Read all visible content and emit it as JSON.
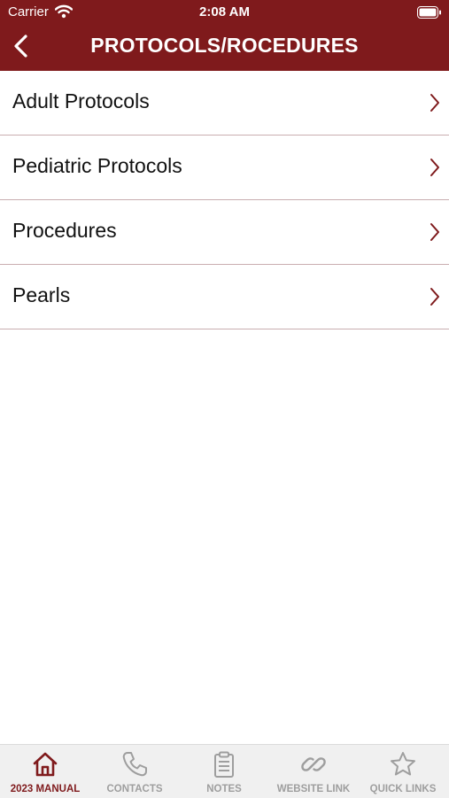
{
  "status_bar": {
    "carrier": "Carrier",
    "time": "2:08 AM"
  },
  "header": {
    "title": "PROTOCOLS/ROCEDURES",
    "back_icon": "chevron-left-icon"
  },
  "list": {
    "items": [
      {
        "label": "Adult Protocols"
      },
      {
        "label": "Pediatric Protocols"
      },
      {
        "label": "Procedures"
      },
      {
        "label": "Pearls"
      }
    ]
  },
  "tabbar": {
    "tabs": [
      {
        "label": "2023 MANUAL",
        "icon": "home-icon",
        "active": true
      },
      {
        "label": "CONTACTS",
        "icon": "phone-icon",
        "active": false
      },
      {
        "label": "NOTES",
        "icon": "clipboard-icon",
        "active": false
      },
      {
        "label": "WEBSITE LINK",
        "icon": "link-icon",
        "active": false
      },
      {
        "label": "QUICK LINKS",
        "icon": "star-icon",
        "active": false
      }
    ]
  },
  "colors": {
    "brand": "#7f1a1c",
    "inactive": "#9e9e9e",
    "divider": "#c9aeb0"
  }
}
